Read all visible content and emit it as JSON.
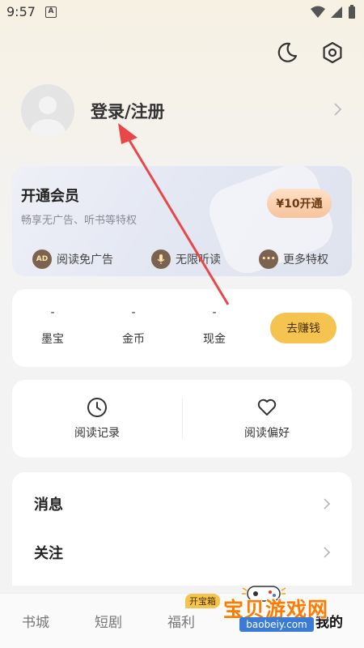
{
  "status_bar": {
    "time": "9:57",
    "notif_letter": "A"
  },
  "header": {
    "moon_icon": "moon-icon",
    "settings_icon": "hexagon-gear-icon"
  },
  "profile": {
    "login_label": "登录/注册"
  },
  "vip": {
    "title": "开通会员",
    "subtitle": "畅享无广告、听书等特权",
    "button_label": "¥10开通",
    "features": [
      {
        "icon_text": "AD",
        "label": "阅读免广告"
      },
      {
        "icon_text": "",
        "label": "无限听读"
      },
      {
        "icon_text": "•••",
        "label": "更多特权"
      }
    ]
  },
  "wallet": {
    "items": [
      {
        "value": "-",
        "label": "墨宝"
      },
      {
        "value": "-",
        "label": "金币"
      },
      {
        "value": "-",
        "label": "现金"
      }
    ],
    "earn_label": "去赚钱"
  },
  "reading": {
    "items": [
      {
        "icon": "clock-icon",
        "label": "阅读记录"
      },
      {
        "icon": "heart-icon",
        "label": "阅读偏好"
      }
    ]
  },
  "menu": {
    "items": [
      {
        "label": "消息"
      },
      {
        "label": "关注"
      }
    ]
  },
  "bottom_nav": {
    "items": [
      {
        "label": "书城"
      },
      {
        "label": "短剧"
      },
      {
        "label": "福利"
      },
      {
        "label": "我的"
      }
    ],
    "badge": "开宝箱"
  },
  "watermark": {
    "title": "宝贝游戏网",
    "url": "baobeiy.com"
  },
  "colors": {
    "accent": "#f5c350",
    "vip_button": "#f7c39c",
    "annotation_arrow": "#e8474a"
  }
}
